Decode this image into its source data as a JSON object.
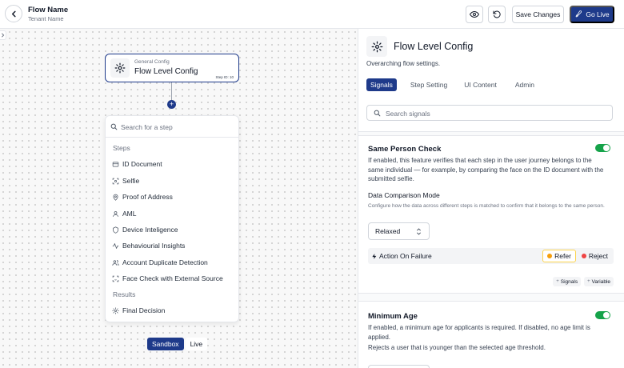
{
  "header": {
    "flow_name": "Flow Name",
    "tenant_name": "Tenant Name",
    "save_label": "Save Changes",
    "go_live_label": "Go Live",
    "icons": [
      "back-icon",
      "eye-icon",
      "undo-icon",
      "rocket-icon"
    ]
  },
  "canvas": {
    "node": {
      "subtitle": "General Config",
      "title": "Flow Level Config",
      "step_id": "Step ID: 10"
    },
    "dropdown": {
      "search_placeholder": "Search for a step",
      "steps_heading": "Steps",
      "steps": [
        {
          "label": "ID Document",
          "icon": "id-card-icon"
        },
        {
          "label": "Selfie",
          "icon": "selfie-icon"
        },
        {
          "label": "Proof of Address",
          "icon": "location-pin-icon"
        },
        {
          "label": "AML",
          "icon": "user-icon"
        },
        {
          "label": "Device Inteligence",
          "icon": "shield-icon"
        },
        {
          "label": "Behaviourial Insights",
          "icon": "activity-icon"
        },
        {
          "label": "Account Duplicate Detection",
          "icon": "users-icon"
        },
        {
          "label": "Face Check with External Source",
          "icon": "face-scan-icon"
        }
      ],
      "results_heading": "Results",
      "results": [
        {
          "label": "Final Decision",
          "icon": "settings-icon"
        }
      ]
    },
    "env": {
      "active": "Sandbox",
      "inactive": "Live"
    }
  },
  "panel": {
    "title": "Flow Level Config",
    "subtitle": "Overarching flow settings.",
    "tabs": [
      "Signals",
      "Step Setting",
      "UI Content",
      "Admin"
    ],
    "search_placeholder": "Search signals",
    "same_person": {
      "title": "Same Person Check",
      "enabled": true,
      "description": "If enabled, this feature verifies that each step in the user journey belongs to the same individual — for example, by comparing the face on the ID document with the submitted selfie.",
      "mode_label": "Data Comparison Mode",
      "mode_description": "Configure how the data across different steps is matched to confirm that it belongs to the same person.",
      "mode_value": "Relaxed",
      "action_label": "Action On Failure",
      "action_options": [
        "Refer",
        "Reject"
      ],
      "action_selected": "Refer",
      "refer_color": "#f59e0b",
      "reject_color": "#ef4444",
      "chips": [
        "Signals",
        "Variable"
      ]
    },
    "min_age": {
      "title": "Minimum Age",
      "enabled": true,
      "description": "If enabled, a minimum age for applicants is required. If disabled, no age limit is applied.",
      "sub_description": "Rejects a user that is younger than the selected age threshold."
    }
  },
  "colors": {
    "primary": "#1e3a8a",
    "toggle_on": "#16a34a"
  }
}
